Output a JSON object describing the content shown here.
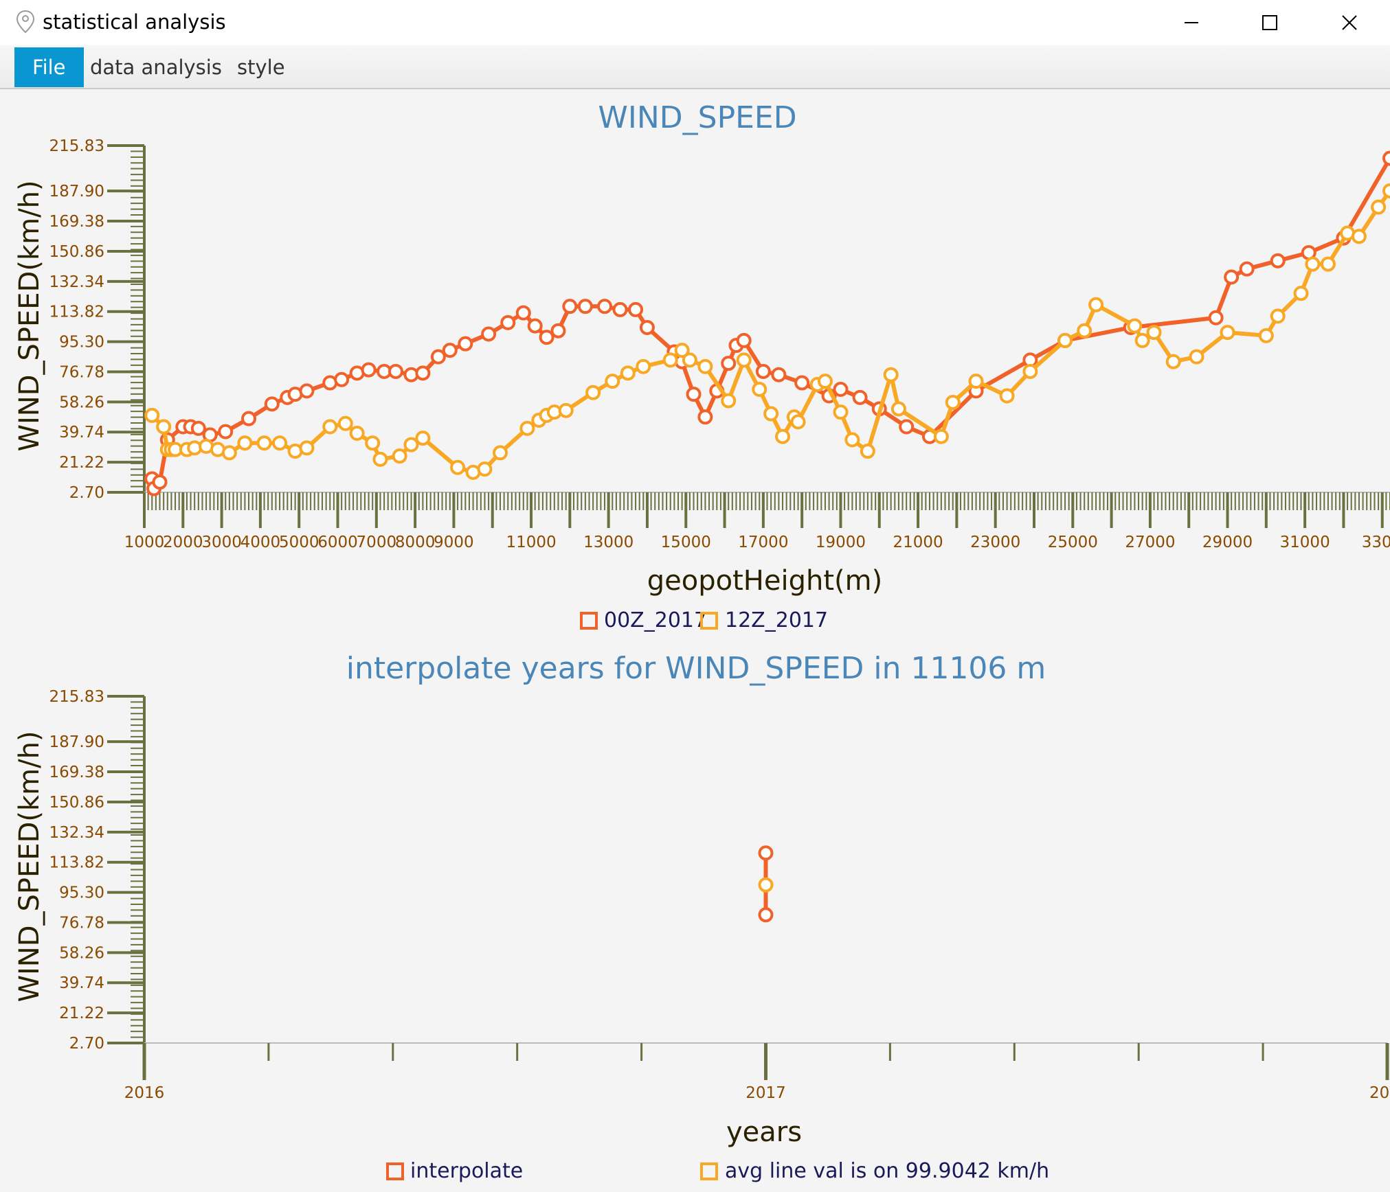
{
  "window": {
    "title": "statistical analysis",
    "icon": "app-pin-icon",
    "controls": [
      "minimize-icon",
      "maximize-icon",
      "close-icon"
    ]
  },
  "menu": [
    {
      "label": "File",
      "active": true
    },
    {
      "label": "data analysis",
      "active": false
    },
    {
      "label": "style",
      "active": false
    }
  ],
  "colors": {
    "series_orange": "#f0622a",
    "series_yellow": "#f9a825",
    "title": "#4a86b8",
    "tick_label": "#8b4a00",
    "axis": "#6b7040"
  },
  "chart_data": [
    {
      "type": "line",
      "title": "WIND_SPEED",
      "xlabel": "geopotHeight(m)",
      "ylabel": "WIND_SPEED(km/h)",
      "xlim": [
        1000,
        33200
      ],
      "ylim": [
        2.7,
        215.83
      ],
      "yticks": [
        "215.83",
        "187.90",
        "169.38",
        "150.86",
        "132.34",
        "113.82",
        "95.30",
        "76.78",
        "58.26",
        "39.74",
        "21.22",
        "2.70"
      ],
      "xticks": [
        "1000",
        "2000",
        "3000",
        "4000",
        "5000",
        "6000",
        "7000",
        "8000",
        "9000",
        "11000",
        "13000",
        "15000",
        "17000",
        "19000",
        "21000",
        "23000",
        "25000",
        "27000",
        "29000",
        "31000",
        "330"
      ],
      "legend_position": "bottom",
      "series": [
        {
          "name": "00Z_2017",
          "color": "#f0622a",
          "points": [
            [
              1200,
              11
            ],
            [
              1250,
              5
            ],
            [
              1400,
              9
            ],
            [
              1600,
              35
            ],
            [
              2000,
              43
            ],
            [
              2200,
              43
            ],
            [
              2400,
              42
            ],
            [
              2700,
              38
            ],
            [
              3100,
              40
            ],
            [
              3700,
              48
            ],
            [
              4300,
              57
            ],
            [
              4700,
              61
            ],
            [
              4900,
              63
            ],
            [
              5200,
              65
            ],
            [
              5800,
              70
            ],
            [
              6100,
              72
            ],
            [
              6500,
              76
            ],
            [
              6800,
              78
            ],
            [
              7200,
              77
            ],
            [
              7500,
              77
            ],
            [
              7900,
              75
            ],
            [
              8200,
              76
            ],
            [
              8600,
              86
            ],
            [
              8900,
              90
            ],
            [
              9300,
              94
            ],
            [
              9900,
              100
            ],
            [
              10400,
              107
            ],
            [
              10800,
              113
            ],
            [
              11100,
              105
            ],
            [
              11400,
              98
            ],
            [
              11700,
              102
            ],
            [
              12000,
              117
            ],
            [
              12400,
              117
            ],
            [
              12900,
              117
            ],
            [
              13300,
              115
            ],
            [
              13700,
              115
            ],
            [
              14000,
              104
            ],
            [
              14700,
              89
            ],
            [
              14900,
              83
            ],
            [
              15200,
              63
            ],
            [
              15500,
              49
            ],
            [
              15800,
              65
            ],
            [
              16100,
              82
            ],
            [
              16300,
              93
            ],
            [
              16500,
              96
            ],
            [
              17000,
              77
            ],
            [
              17400,
              75
            ],
            [
              18000,
              70
            ],
            [
              18700,
              62
            ],
            [
              19000,
              66
            ],
            [
              19500,
              61
            ],
            [
              20000,
              54
            ],
            [
              20700,
              43
            ],
            [
              21300,
              37
            ],
            [
              22500,
              65
            ],
            [
              23900,
              84
            ],
            [
              24800,
              96
            ],
            [
              26500,
              104
            ],
            [
              28700,
              110
            ],
            [
              29100,
              135
            ],
            [
              29500,
              140
            ],
            [
              30300,
              145
            ],
            [
              31100,
              150
            ],
            [
              32000,
              159
            ],
            [
              33200,
              208
            ]
          ]
        },
        {
          "name": "12Z_2017",
          "color": "#f9a825",
          "points": [
            [
              1200,
              50
            ],
            [
              1500,
              43
            ],
            [
              1600,
              29
            ],
            [
              1700,
              29
            ],
            [
              1800,
              29
            ],
            [
              2100,
              29
            ],
            [
              2300,
              30
            ],
            [
              2600,
              31
            ],
            [
              2900,
              29
            ],
            [
              3200,
              27
            ],
            [
              3600,
              33
            ],
            [
              4100,
              33
            ],
            [
              4500,
              33
            ],
            [
              4900,
              28
            ],
            [
              5200,
              30
            ],
            [
              5800,
              43
            ],
            [
              6200,
              45
            ],
            [
              6500,
              39
            ],
            [
              6900,
              33
            ],
            [
              7100,
              23
            ],
            [
              7600,
              25
            ],
            [
              7900,
              32
            ],
            [
              8200,
              36
            ],
            [
              9100,
              18
            ],
            [
              9500,
              15
            ],
            [
              9800,
              17
            ],
            [
              10200,
              27
            ],
            [
              10900,
              42
            ],
            [
              11200,
              47
            ],
            [
              11400,
              50
            ],
            [
              11600,
              52
            ],
            [
              11900,
              53
            ],
            [
              12600,
              64
            ],
            [
              13100,
              71
            ],
            [
              13500,
              76
            ],
            [
              13900,
              80
            ],
            [
              14600,
              84
            ],
            [
              14900,
              90
            ],
            [
              15100,
              84
            ],
            [
              15500,
              80
            ],
            [
              16100,
              59
            ],
            [
              16500,
              84
            ],
            [
              16900,
              66
            ],
            [
              17200,
              51
            ],
            [
              17500,
              37
            ],
            [
              17800,
              49
            ],
            [
              17900,
              46
            ],
            [
              18400,
              69
            ],
            [
              18600,
              71
            ],
            [
              19000,
              52
            ],
            [
              19300,
              35
            ],
            [
              19700,
              28
            ],
            [
              20300,
              75
            ],
            [
              20500,
              54
            ],
            [
              21600,
              37
            ],
            [
              21900,
              58
            ],
            [
              22500,
              71
            ],
            [
              23300,
              62
            ],
            [
              23900,
              77
            ],
            [
              24800,
              96
            ],
            [
              25300,
              102
            ],
            [
              25600,
              118
            ],
            [
              26600,
              105
            ],
            [
              26800,
              96
            ],
            [
              27100,
              101
            ],
            [
              27600,
              83
            ],
            [
              28200,
              86
            ],
            [
              29000,
              101
            ],
            [
              30000,
              99
            ],
            [
              30300,
              111
            ],
            [
              30900,
              125
            ],
            [
              31200,
              143
            ],
            [
              31600,
              143
            ],
            [
              32100,
              162
            ],
            [
              32400,
              160
            ],
            [
              32900,
              178
            ],
            [
              33200,
              188
            ]
          ]
        }
      ]
    },
    {
      "type": "line",
      "title": "interpolate years for WIND_SPEED in 11106 m",
      "xlabel": "years",
      "ylabel": "WIND_SPEED(km/h)",
      "xlim": [
        2016,
        2018
      ],
      "ylim": [
        2.7,
        215.83
      ],
      "yticks": [
        "215.83",
        "187.90",
        "169.38",
        "150.86",
        "132.34",
        "113.82",
        "95.30",
        "76.78",
        "58.26",
        "39.74",
        "21.22",
        "2.70"
      ],
      "xticks": [
        "2016",
        "2017",
        "20"
      ],
      "legend_position": "bottom",
      "series": [
        {
          "name": "interpolate",
          "color": "#f0622a",
          "points": [
            [
              2017,
              119.5
            ],
            [
              2017,
              81.5
            ]
          ]
        },
        {
          "name": "avg line val is on 99.9042 km/h",
          "color": "#f9a825",
          "points": [
            [
              2017,
              99.9042
            ]
          ]
        }
      ]
    }
  ]
}
